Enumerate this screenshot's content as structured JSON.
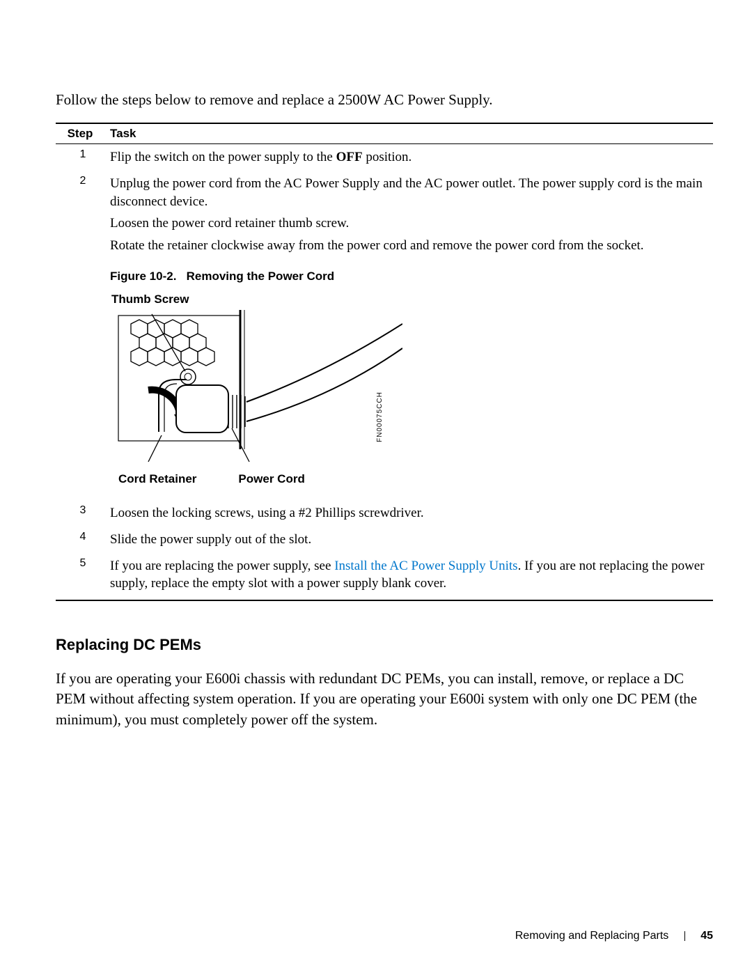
{
  "intro": "Follow the steps below to remove and replace a 2500W AC Power Supply.",
  "table": {
    "header_step": "Step",
    "header_task": "Task",
    "rows": [
      {
        "num": "1",
        "task_pre": "Flip the switch on the power supply to the ",
        "task_bold": "OFF",
        "task_post": " position."
      },
      {
        "num": "2",
        "task": "Unplug the power cord from the AC Power Supply and the AC power outlet. The power supply cord is the main disconnect device.",
        "sub1": "Loosen the power cord retainer thumb screw.",
        "sub2": "Rotate the retainer clockwise away from the power cord and remove the power cord from the socket."
      },
      {
        "num": "3",
        "task": "Loosen the locking screws, using a #2 Phillips screwdriver."
      },
      {
        "num": "4",
        "task": "Slide the power supply out of the slot."
      },
      {
        "num": "5",
        "task_pre": "If you are replacing the power supply, see ",
        "task_link": "Install the AC Power Supply Units",
        "task_post": ". If you are not replacing the power supply, replace the empty slot with a power supply blank cover."
      }
    ]
  },
  "figure": {
    "caption_prefix": "Figure 10-2.",
    "caption_title": "Removing the Power Cord",
    "label_top": "Thumb Screw",
    "label_bottom_left": "Cord Retainer",
    "label_bottom_right": "Power Cord",
    "ref_code": "FN00075CCH"
  },
  "section": {
    "heading": "Replacing DC PEMs",
    "body": "If you are operating your E600i chassis with redundant DC PEMs, you can install, remove, or replace a DC PEM without affecting system operation. If you are operating your E600i system with only one DC PEM (the minimum), you must completely power off the system."
  },
  "footer": {
    "chapter": "Removing and Replacing Parts",
    "page": "45"
  }
}
